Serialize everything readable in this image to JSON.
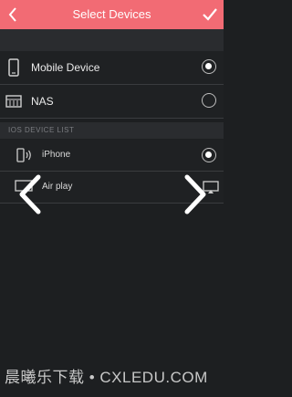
{
  "header": {
    "title": "Select Devices",
    "back_icon": "chevron-left-icon",
    "confirm_icon": "check-icon"
  },
  "devices": [
    {
      "label": "Mobile Device",
      "icon": "phone-icon",
      "selected": true
    },
    {
      "label": "NAS",
      "icon": "nas-icon",
      "selected": false
    }
  ],
  "ios_section": {
    "title": "IOS DEVICE LIST",
    "items": [
      {
        "label": "iPhone",
        "icon": "iphone-signal-icon",
        "selected": true
      },
      {
        "label": "Air play",
        "icon": "airplay-icon",
        "selected": false
      }
    ]
  },
  "overlay": {
    "left_icon": "chevron-left-icon",
    "right_icon": "chevron-right-icon"
  },
  "watermark": "晨曦乐下载 • CXLEDU.COM",
  "colors": {
    "header": "#f26b74",
    "background": "#1d1f21"
  }
}
